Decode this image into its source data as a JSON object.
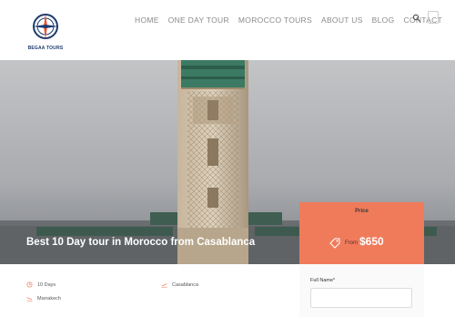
{
  "brand": {
    "logo_text": "BEGAA TOURS"
  },
  "nav": {
    "items": [
      "HOME",
      "ONE DAY TOUR",
      "MOROCCO TOURS",
      "ABOUT US",
      "BLOG",
      "CONTACT"
    ]
  },
  "icons": {
    "search": "search-icon",
    "menu": "menu-icon"
  },
  "hero": {
    "title": "Best 10 Day tour in Morocco from Casablanca"
  },
  "price_card": {
    "label": "Price",
    "from": "From",
    "value": "$650",
    "accent": "#f07b5b"
  },
  "details": {
    "duration": "10 Days",
    "start": "Casablanca",
    "end": "Marrakech",
    "accent": "#f07b5b"
  },
  "form": {
    "full_name_label": "Full Name*",
    "full_name_value": ""
  }
}
